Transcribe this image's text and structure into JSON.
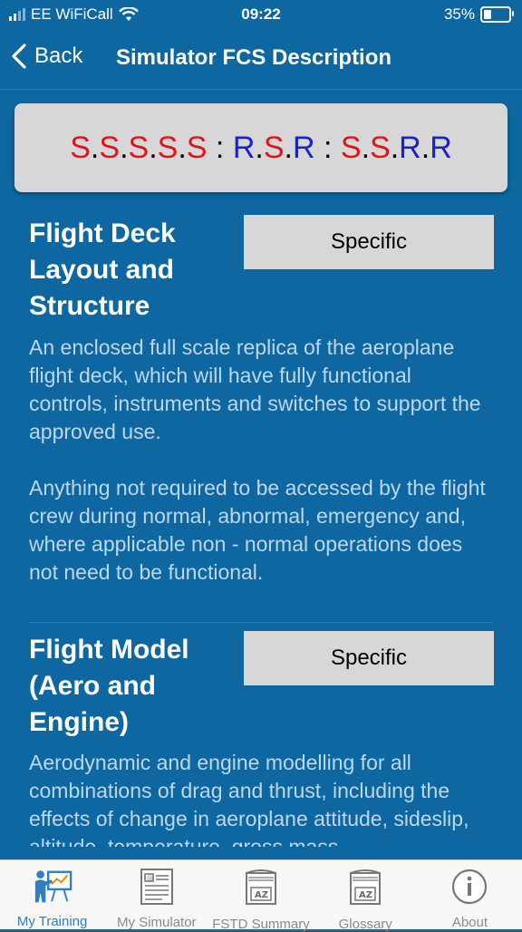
{
  "status_bar": {
    "carrier": "EE WiFiCall",
    "time": "09:22",
    "battery": "35%"
  },
  "nav": {
    "back_label": "Back",
    "title": "Simulator FCS Description"
  },
  "code": {
    "colors": {
      "red": "#e0141b",
      "blue": "#1a1fd2",
      "black": "#000000"
    },
    "segments": [
      {
        "text": "S",
        "color": "red"
      },
      {
        "text": ".",
        "color": "black"
      },
      {
        "text": "S",
        "color": "red"
      },
      {
        "text": ".",
        "color": "black"
      },
      {
        "text": "S",
        "color": "red"
      },
      {
        "text": ".",
        "color": "black"
      },
      {
        "text": "S",
        "color": "red"
      },
      {
        "text": ".",
        "color": "black"
      },
      {
        "text": "S",
        "color": "red"
      },
      {
        "text": " : ",
        "color": "black"
      },
      {
        "text": "R",
        "color": "blue"
      },
      {
        "text": ".",
        "color": "black"
      },
      {
        "text": "S",
        "color": "red"
      },
      {
        "text": ".",
        "color": "black"
      },
      {
        "text": "R",
        "color": "blue"
      },
      {
        "text": " : ",
        "color": "black"
      },
      {
        "text": "S",
        "color": "red"
      },
      {
        "text": ".",
        "color": "black"
      },
      {
        "text": "S",
        "color": "red"
      },
      {
        "text": ".",
        "color": "black"
      },
      {
        "text": "R",
        "color": "blue"
      },
      {
        "text": ".",
        "color": "black"
      },
      {
        "text": "R",
        "color": "blue"
      }
    ]
  },
  "sections": [
    {
      "title_lines": [
        "Flight Deck",
        "Layout and",
        "Structure"
      ],
      "level": "Specific",
      "paragraphs": [
        "An enclosed full scale replica of the aeroplane flight deck, which will have fully functional controls, instruments and switches to support the approved use.",
        "Anything not required to be accessed by the flight crew during normal, abnormal, emergency and, where applicable non - normal operations does not need to be functional."
      ]
    },
    {
      "title_lines": [
        "Flight Model",
        "(Aero and",
        "Engine)"
      ],
      "level": "Specific",
      "paragraphs": [
        "Aerodynamic and engine modelling for all combinations of drag and thrust, including the effects of change in aeroplane attitude, sideslip, altitude, temperature, gross mass"
      ]
    }
  ],
  "tabs": [
    {
      "label": "My Training",
      "icon": "trainer-icon",
      "active": true
    },
    {
      "label": "My Simulator",
      "icon": "simulator-doc-icon",
      "active": false
    },
    {
      "label": "FSTD Summary",
      "icon": "az-book-icon",
      "active": false
    },
    {
      "label": "Glossary",
      "icon": "az-book-icon",
      "active": false
    },
    {
      "label": "About",
      "icon": "info-icon",
      "active": false
    }
  ]
}
